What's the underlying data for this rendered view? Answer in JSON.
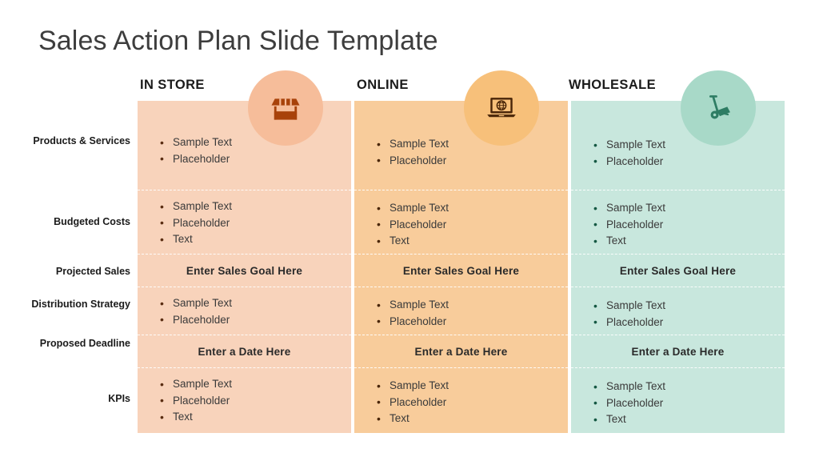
{
  "slide": {
    "title": "Sales Action Plan Slide Template"
  },
  "columns": [
    {
      "key": "in-store",
      "label": "IN STORE",
      "icon": "market-stall-icon",
      "band_color": "#f8d3bb",
      "circle_color": "#f6bd9a",
      "icon_color": "#a8420a"
    },
    {
      "key": "online",
      "label": "ONLINE",
      "icon": "laptop-globe-icon",
      "band_color": "#f8cc9b",
      "circle_color": "#f7c07a",
      "icon_color": "#4a2609"
    },
    {
      "key": "wholesale",
      "label": "WHOLESALE",
      "icon": "hand-truck-icon",
      "band_color": "#c8e7dd",
      "circle_color": "#a8d9c8",
      "icon_color": "#2e7d64"
    }
  ],
  "rows": [
    {
      "key": "products-services",
      "label": "Products & Services",
      "type": "bullets",
      "cells": [
        [
          "Sample Text",
          "Placeholder"
        ],
        [
          "Sample Text",
          "Placeholder"
        ],
        [
          "Sample Text",
          "Placeholder"
        ]
      ]
    },
    {
      "key": "budgeted-costs",
      "label": "Budgeted Costs",
      "type": "bullets",
      "cells": [
        [
          "Sample Text",
          "Placeholder",
          "Text"
        ],
        [
          "Sample Text",
          "Placeholder",
          "Text"
        ],
        [
          "Sample Text",
          "Placeholder",
          "Text"
        ]
      ]
    },
    {
      "key": "projected-sales",
      "label": "Projected Sales",
      "type": "note",
      "cells": [
        "Enter Sales Goal Here",
        "Enter Sales Goal Here",
        "Enter Sales Goal Here"
      ]
    },
    {
      "key": "distribution-strategy",
      "label": "Distribution Strategy",
      "type": "bullets",
      "cells": [
        [
          "Sample Text",
          "Placeholder"
        ],
        [
          "Sample Text",
          "Placeholder"
        ],
        [
          "Sample Text",
          "Placeholder"
        ]
      ]
    },
    {
      "key": "proposed-deadline",
      "label": "Proposed Deadline",
      "type": "note",
      "cells": [
        "Enter a Date Here",
        "Enter a Date Here",
        "Enter a Date Here"
      ]
    },
    {
      "key": "kpis",
      "label": "KPIs",
      "type": "bullets",
      "cells": [
        [
          "Sample Text",
          "Placeholder",
          "Text"
        ],
        [
          "Sample Text",
          "Placeholder",
          "Text"
        ],
        [
          "Sample Text",
          "Placeholder",
          "Text"
        ]
      ]
    }
  ]
}
